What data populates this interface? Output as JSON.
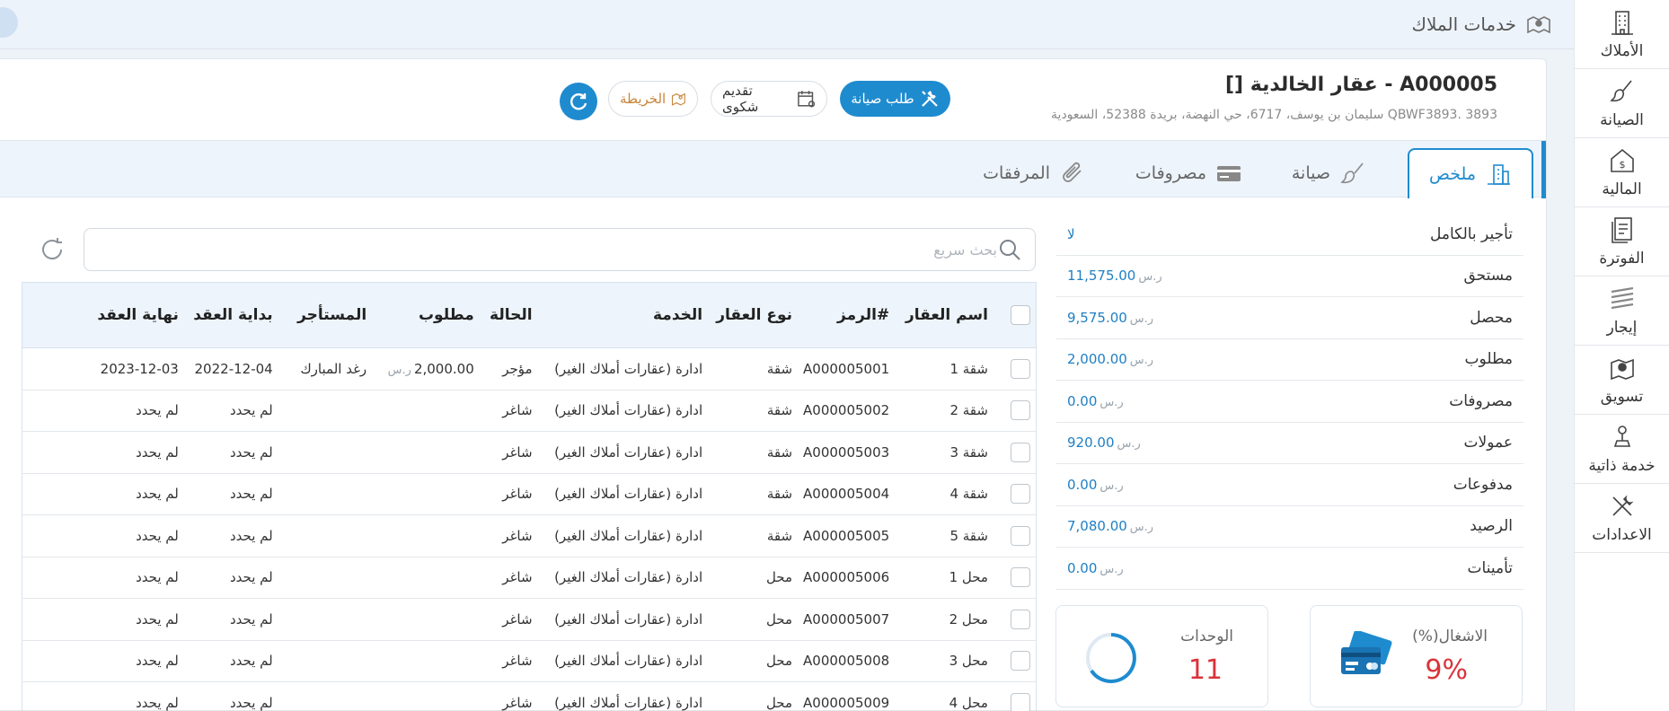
{
  "nav": {
    "items": [
      {
        "label": "الأملاك",
        "icon": "building-icon"
      },
      {
        "label": "الصيانة",
        "icon": "paintbrush-icon"
      },
      {
        "label": "المالية",
        "icon": "finance-house-icon"
      },
      {
        "label": "الفوترة",
        "icon": "invoice-icon"
      },
      {
        "label": "إيجار",
        "icon": "rent-stack-icon"
      },
      {
        "label": "تسويق",
        "icon": "marketing-map-icon"
      },
      {
        "label": "خدمة ذاتية",
        "icon": "self-service-icon"
      },
      {
        "label": "الاعدادات",
        "icon": "settings-tools-icon"
      }
    ]
  },
  "topbar": {
    "title": "خدمات الملاك"
  },
  "property": {
    "title": "A000005 - عقار الخالدية []",
    "address": "3893 .QBWF3893 سليمان بن يوسف، 6717، حي النهضة، بريدة 52388، السعودية"
  },
  "actions": {
    "maintenance": "طلب صيانة",
    "complaint": "تقديم شكوى",
    "map": "الخريطة"
  },
  "tabs": [
    {
      "label": "ملخص",
      "icon": "summary-building-icon",
      "active": true
    },
    {
      "label": "صيانة",
      "icon": "brush-icon",
      "active": false
    },
    {
      "label": "مصروفات",
      "icon": "card-icon",
      "active": false
    },
    {
      "label": "المرفقات",
      "icon": "paperclip-icon",
      "active": false
    }
  ],
  "summary": {
    "currency": "ر.س",
    "rows": [
      {
        "label": "تأجير بالكامل",
        "value": "لا",
        "has_currency": false
      },
      {
        "label": "مستحق",
        "value": "11,575.00",
        "has_currency": true
      },
      {
        "label": "محصل",
        "value": "9,575.00",
        "has_currency": true
      },
      {
        "label": "مطلوب",
        "value": "2,000.00",
        "has_currency": true
      },
      {
        "label": "مصروفات",
        "value": "0.00",
        "has_currency": true
      },
      {
        "label": "عمولات",
        "value": "920.00",
        "has_currency": true
      },
      {
        "label": "مدفوعات",
        "value": "0.00",
        "has_currency": true
      },
      {
        "label": "الرصيد",
        "value": "7,080.00",
        "has_currency": true
      },
      {
        "label": "تأمينات",
        "value": "0.00",
        "has_currency": true
      }
    ],
    "occupancy": {
      "label": "الاشغال(%)",
      "value": "9%"
    },
    "units": {
      "label": "الوحدات",
      "value": "11"
    }
  },
  "search": {
    "placeholder": "بحث سريع"
  },
  "table": {
    "headers": {
      "name": "اسم العقار",
      "code": "#الرمز",
      "type": "نوع العقار",
      "service": "الخدمة",
      "status": "الحالة",
      "due": "مطلوب",
      "tenant": "المستأجر",
      "start": "بداية العقد",
      "end": "نهاية العقد"
    },
    "currency": "ر.س",
    "rows": [
      {
        "name": "شقة 1",
        "code": "A000005001",
        "type": "شقة",
        "service": "ادارة (عقارات أملاك الغير)",
        "status": "مؤجر",
        "due": "2,000.00",
        "tenant": "رغد المبارك",
        "start": "2022-12-04",
        "end": "2023-12-03"
      },
      {
        "name": "شقة 2",
        "code": "A000005002",
        "type": "شقة",
        "service": "ادارة (عقارات أملاك الغير)",
        "status": "شاغر",
        "due": "",
        "tenant": "",
        "start": "لم يحدد",
        "end": "لم يحدد"
      },
      {
        "name": "شقة 3",
        "code": "A000005003",
        "type": "شقة",
        "service": "ادارة (عقارات أملاك الغير)",
        "status": "شاغر",
        "due": "",
        "tenant": "",
        "start": "لم يحدد",
        "end": "لم يحدد"
      },
      {
        "name": "شقة 4",
        "code": "A000005004",
        "type": "شقة",
        "service": "ادارة (عقارات أملاك الغير)",
        "status": "شاغر",
        "due": "",
        "tenant": "",
        "start": "لم يحدد",
        "end": "لم يحدد"
      },
      {
        "name": "شقة 5",
        "code": "A000005005",
        "type": "شقة",
        "service": "ادارة (عقارات أملاك الغير)",
        "status": "شاغر",
        "due": "",
        "tenant": "",
        "start": "لم يحدد",
        "end": "لم يحدد"
      },
      {
        "name": "محل 1",
        "code": "A000005006",
        "type": "محل",
        "service": "ادارة (عقارات أملاك الغير)",
        "status": "شاغر",
        "due": "",
        "tenant": "",
        "start": "لم يحدد",
        "end": "لم يحدد"
      },
      {
        "name": "محل 2",
        "code": "A000005007",
        "type": "محل",
        "service": "ادارة (عقارات أملاك الغير)",
        "status": "شاغر",
        "due": "",
        "tenant": "",
        "start": "لم يحدد",
        "end": "لم يحدد"
      },
      {
        "name": "محل 3",
        "code": "A000005008",
        "type": "محل",
        "service": "ادارة (عقارات أملاك الغير)",
        "status": "شاغر",
        "due": "",
        "tenant": "",
        "start": "لم يحدد",
        "end": "لم يحدد"
      },
      {
        "name": "محل 4",
        "code": "A000005009",
        "type": "محل",
        "service": "ادارة (عقارات أملاك الغير)",
        "status": "شاغر",
        "due": "",
        "tenant": "",
        "start": "لم يحدد",
        "end": "لم يحدد"
      }
    ]
  },
  "colors": {
    "accent": "#1f8bcf",
    "alert": "#d9343a",
    "map": "#c9853a"
  }
}
